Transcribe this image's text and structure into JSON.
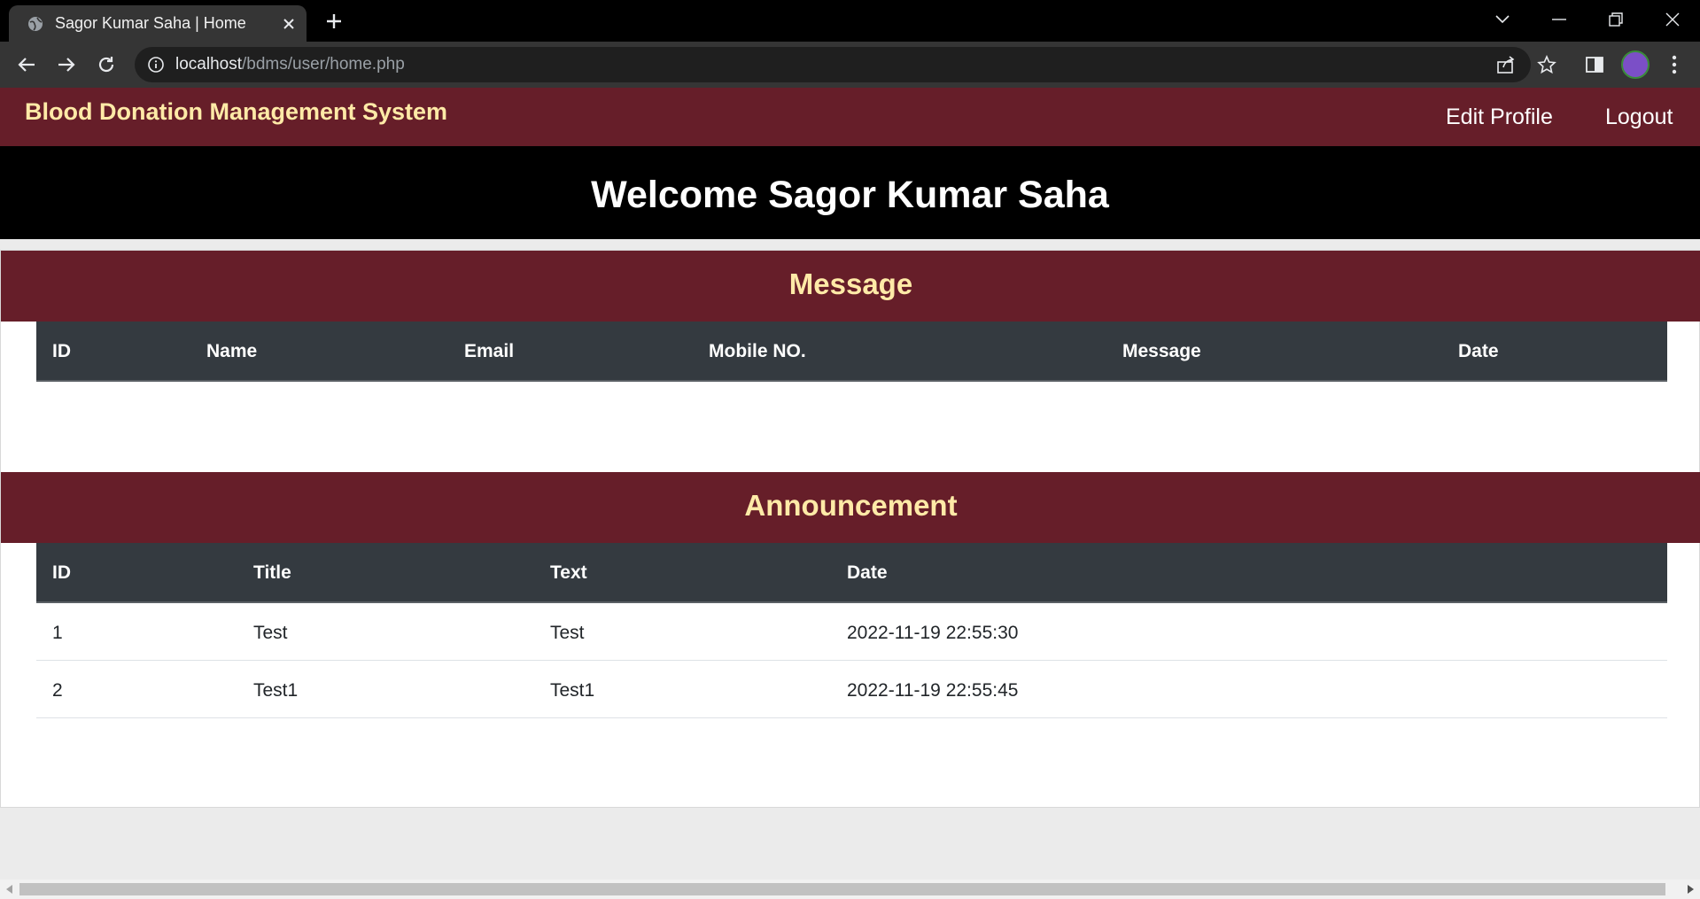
{
  "browser": {
    "tab_title": "Sagor Kumar Saha | Home",
    "url_host": "localhost",
    "url_path": "/bdms/user/home.php"
  },
  "header": {
    "brand": "Blood Donation Management System",
    "nav": [
      "Edit Profile",
      "Logout"
    ]
  },
  "welcome": "Welcome Sagor Kumar Saha",
  "message_section": {
    "title": "Message",
    "columns": [
      "ID",
      "Name",
      "Email",
      "Mobile NO.",
      "Message",
      "Date"
    ],
    "rows": []
  },
  "announcement_section": {
    "title": "Announcement",
    "columns": [
      "ID",
      "Title",
      "Text",
      "Date"
    ],
    "rows": [
      {
        "id": "1",
        "title": "Test",
        "text": "Test",
        "date": "2022-11-19 22:55:30"
      },
      {
        "id": "2",
        "title": "Test1",
        "text": "Test1",
        "date": "2022-11-19 22:55:45"
      }
    ]
  },
  "colors": {
    "header_bg": "#661e29",
    "accent_text": "#ffeaa7",
    "table_head": "#343a40"
  }
}
